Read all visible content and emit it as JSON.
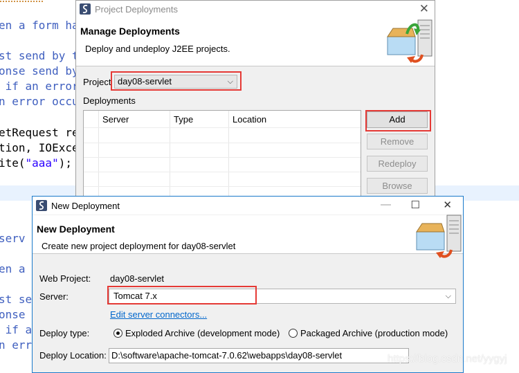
{
  "editor": {
    "lines": [
      {
        "text": "en a form ha",
        "class": "comment"
      },
      {
        "text": "st send by t",
        "class": "comment"
      },
      {
        "text": "onse send by",
        "class": "comment"
      },
      {
        "text": " if an error",
        "class": "comment"
      },
      {
        "text": "n error occu",
        "class": "comment"
      },
      {
        "text": "etRequest re",
        "class": "plain"
      },
      {
        "text": "tion, IOExce",
        "class": "plain"
      },
      {
        "text": "ite(",
        "class": "plain"
      },
      {
        "text": "serv",
        "class": "comment"
      },
      {
        "text": "en a f",
        "class": "comment"
      },
      {
        "text": "st ser",
        "class": "comment"
      },
      {
        "text": "onse",
        "class": "comment"
      },
      {
        "text": " if ar",
        "class": "comment"
      },
      {
        "text": "n erro",
        "class": "comment"
      }
    ],
    "string_literal": "\"aaa\"",
    "string_suffix": ");"
  },
  "project_deployments": {
    "title": "Project Deployments",
    "close_icon": "close-icon",
    "header_title": "Manage Deployments",
    "header_desc": "Deploy and undeploy J2EE projects.",
    "project_label": "Project",
    "project_value": "day08-servlet",
    "deployments_label": "Deployments",
    "columns": [
      "Server",
      "Type",
      "Location"
    ],
    "buttons": {
      "add": "Add",
      "remove": "Remove",
      "redeploy": "Redeploy",
      "browse": "Browse"
    }
  },
  "new_deployment": {
    "title": "New Deployment",
    "header_title": "New Deployment",
    "header_desc": "Create new project deployment for day08-servlet",
    "web_project_label": "Web Project:",
    "web_project_value": "day08-servlet",
    "server_label": "Server:",
    "server_value": "Tomcat  7.x",
    "link_text": "Edit server connectors...",
    "deploy_type_label": "Deploy type:",
    "radio_exploded": "Exploded Archive (development mode)",
    "radio_packaged": "Packaged Archive (production mode)",
    "deploy_location_label": "Deploy Location:",
    "deploy_location_value": "D:\\software\\apache-tomcat-7.0.62\\webapps\\day08-servlet",
    "window_controls": {
      "minimize": "—",
      "maximize": "☐",
      "close": "✕"
    }
  },
  "watermark": "https://blog.csdn.net/yygyj",
  "colors": {
    "comment": "#3f5fbf",
    "string": "#2a00ff",
    "highlight": "#e53935",
    "link": "#0066cc",
    "active_border": "#1979ca"
  }
}
